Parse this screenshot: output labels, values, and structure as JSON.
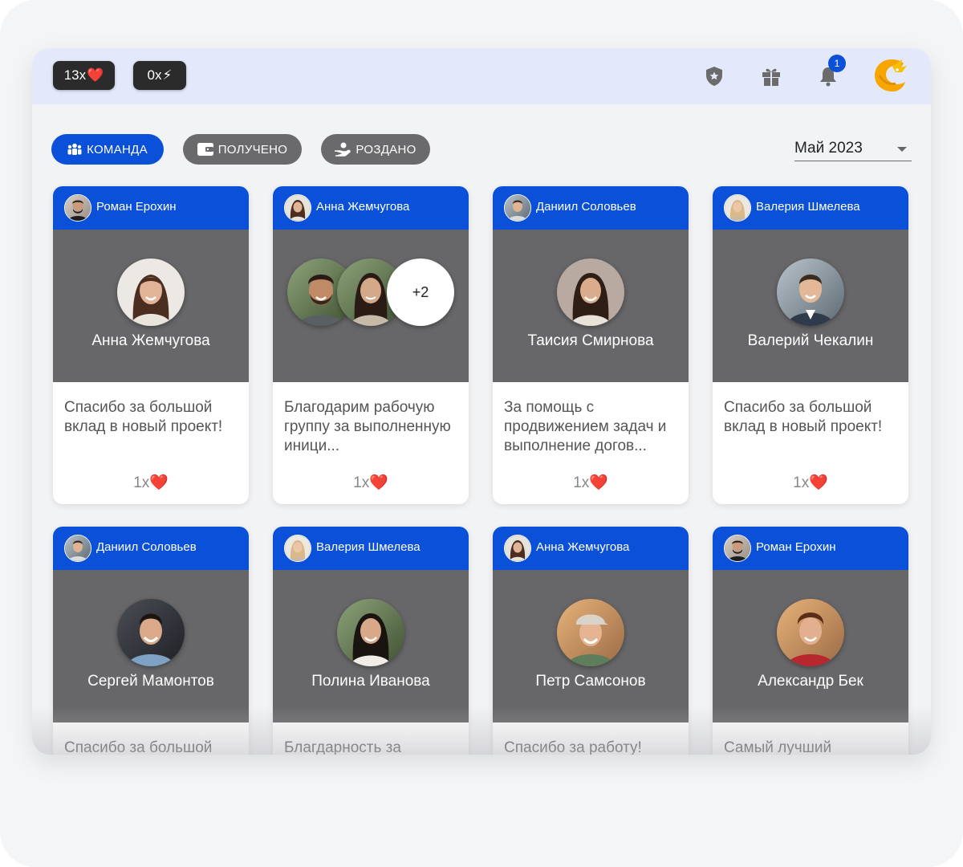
{
  "header": {
    "hearts_count": "13x",
    "hearts_emoji": "❤️",
    "energy_count": "0x",
    "energy_emoji": "⚡",
    "notifications_badge": "1",
    "icons": [
      "shield-star-icon",
      "gift-icon",
      "bell-icon",
      "dragon-logo"
    ]
  },
  "tabs": [
    {
      "label": "КОМАНДА",
      "icon": "team-icon",
      "active": true
    },
    {
      "label": "ПОЛУЧЕНО",
      "icon": "wallet-icon",
      "active": false
    },
    {
      "label": "РОЗДАНО",
      "icon": "hand-give-icon",
      "active": false
    }
  ],
  "period": {
    "value": "Май 2023"
  },
  "colors": {
    "accent": "#0a50d8",
    "media_bg": "#676769",
    "pill_bg": "#2b2b2b",
    "topbar_bg": "#e3e9fb"
  },
  "cards": [
    {
      "sender": "Роман Ерохин",
      "recipient": "Анна Жемчугова",
      "message": "Спасибо за большой вклад в новый проект!",
      "count": "1x"
    },
    {
      "sender": "Анна Жемчугова",
      "recipient": "",
      "extra_recipients": "+2",
      "message": "Благодарим рабочую группу за выполненную иници...",
      "count": "1x"
    },
    {
      "sender": "Даниил Соловьев",
      "recipient": "Таисия Смирнова",
      "message": "За помощь с продвижением задач и выполнение догов...",
      "count": "1x"
    },
    {
      "sender": "Валерия Шмелева",
      "recipient": "Валерий Чекалин",
      "message": "Спасибо за большой вклад в новый проект!",
      "count": "1x"
    },
    {
      "sender": "Даниил Соловьев",
      "recipient": "Сергей Мамонтов",
      "message": "Спасибо за большой",
      "count": ""
    },
    {
      "sender": "Валерия Шмелева",
      "recipient": "Полина Иванова",
      "message": "Благдарность за",
      "count": ""
    },
    {
      "sender": "Анна Жемчугова",
      "recipient": "Петр Самсонов",
      "message": "Спасибо за работу!",
      "count": ""
    },
    {
      "sender": "Роман Ерохин",
      "recipient": "Александр Бек",
      "message": "Самый лучший",
      "count": ""
    }
  ],
  "heart_emoji": "❤️"
}
